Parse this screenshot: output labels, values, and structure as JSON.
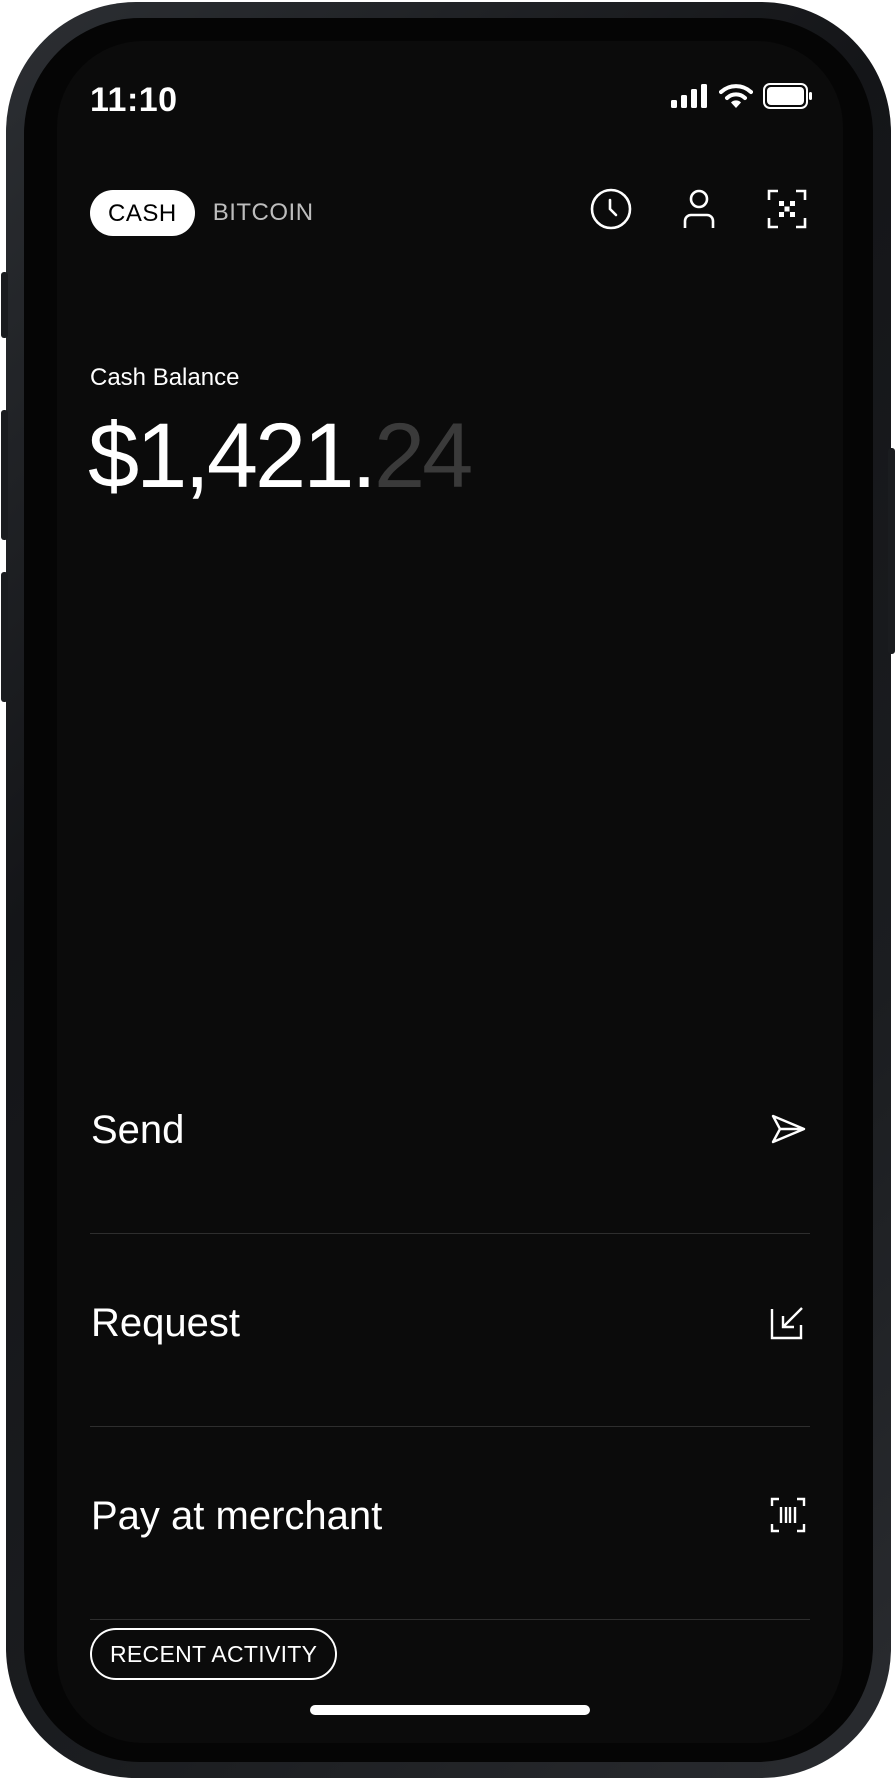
{
  "status_bar": {
    "time": "11:10"
  },
  "toggle": {
    "active": "CASH",
    "inactive": "BITCOIN"
  },
  "header_icons": [
    "clock-icon",
    "profile-icon",
    "scan-qr-icon"
  ],
  "balance": {
    "label": "Cash Balance",
    "whole": "$1,421.",
    "cents": "24"
  },
  "actions": [
    {
      "label": "Send",
      "icon": "send-icon"
    },
    {
      "label": "Request",
      "icon": "request-arrow-icon"
    },
    {
      "label": "Pay at merchant",
      "icon": "barcode-scan-icon"
    }
  ],
  "recent_activity": "RECENT ACTIVITY",
  "colors": {
    "background": "#0b0b0b",
    "text": "#ffffff",
    "muted": "#bdbdbd",
    "cents": "#3a3a3a",
    "divider": "#2e2e2e"
  }
}
